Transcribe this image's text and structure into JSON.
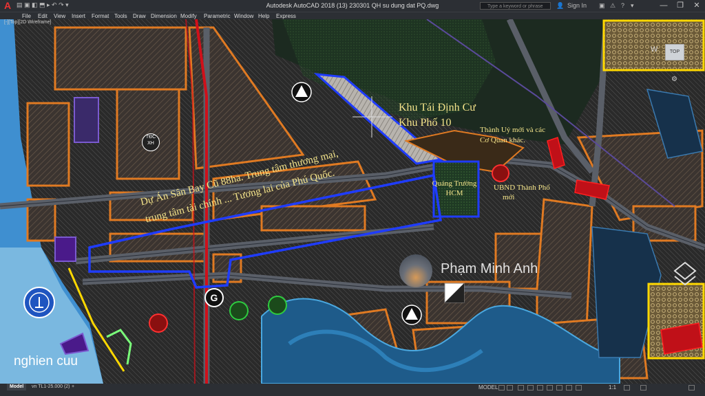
{
  "app": {
    "title": "Autodesk AutoCAD 2018   (13) 230301 QH su dung dat PQ.dwg",
    "app_button": "A",
    "quick_access": "▤ ▣ ◧ ⬒ ▸ ↶ ↷ ▾",
    "search_placeholder": "Type a keyword or phrase",
    "sign_in": "Sign In",
    "window_controls": [
      "—",
      "❐",
      "✕"
    ]
  },
  "menu": [
    "File",
    "Edit",
    "View",
    "Insert",
    "Format",
    "Tools",
    "Draw",
    "Dimension",
    "Modify",
    "Parametric",
    "Window",
    "Help",
    "Express"
  ],
  "viewport": {
    "label": "[-][Top][2D Wireframe]",
    "labels": {
      "khu_tai_dinh_cu_1": "Khu Tái Định Cư",
      "khu_tai_dinh_cu_2": "Khu Phố 10",
      "thanh_uy_1": "Thành Uỷ mới và các",
      "thanh_uy_2": "Cơ Quan khác.",
      "ubnd_1": "UBND Thành Phố",
      "ubnd_2": "mới",
      "quang_truong_1": "Quảng Trường",
      "quang_truong_2": "HCM",
      "du_an_1": "Dự Án Sân Bay Cũ 88ha. Trung tâm thương mại,",
      "du_an_2": "trung tâm tài chính ... Tương lai của Phú Quốc.",
      "tdc_xh": "TĐC XH"
    },
    "watermark_name": "Phạm Minh Anh",
    "watermark_corner": "nghien cuu",
    "viewcube_face": "TOP",
    "viewcube_w": "W"
  },
  "tabs": [
    "Model",
    "vn TL1-25.000 (2)",
    "+"
  ],
  "status": {
    "model": "MODEL",
    "scale": "1:1",
    "icons": [
      "grid",
      "snap",
      "ortho",
      "polar",
      "osnap",
      "otrack",
      "lweight",
      "transparency",
      "annotation",
      "workspace",
      "settings",
      "fullscreen"
    ]
  },
  "colors": {
    "orange": "#e07a22",
    "blue_boundary": "#1f3cff",
    "yellow_label": "#f4e48a",
    "red_road": "#d0101a",
    "water": "#4aa8e0"
  }
}
